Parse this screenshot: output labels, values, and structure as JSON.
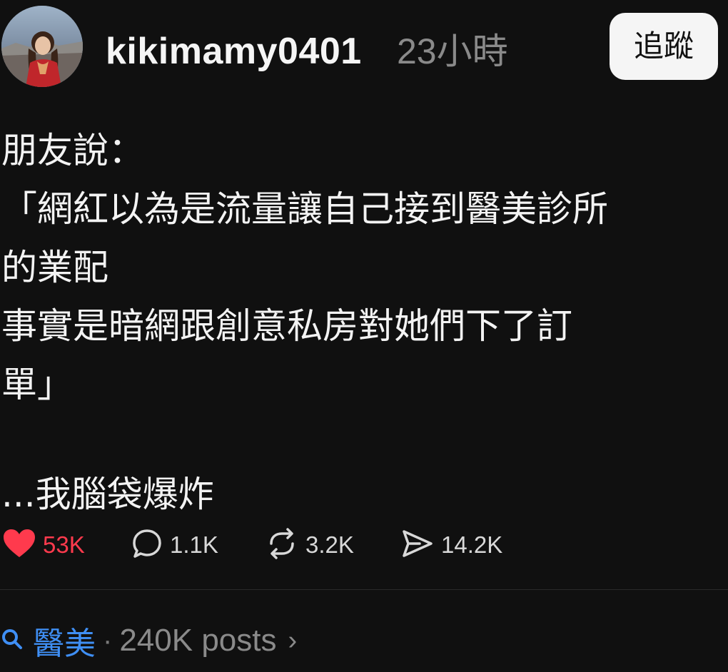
{
  "post": {
    "username": "kikimamy0401",
    "timestamp": "23小時",
    "follow_label": "追蹤",
    "body_lines": [
      "朋友說：",
      "「網紅以為是流量讓自己接到醫美診所",
      "的業配",
      "事實是暗網跟創意私房對她們下了訂",
      "單」",
      "",
      "...我腦袋爆炸"
    ]
  },
  "actions": {
    "likes": "53K",
    "replies": "1.1K",
    "reposts": "3.2K",
    "shares": "14.2K"
  },
  "topic": {
    "name": "醫美",
    "separator": "·",
    "posts_count": "240K posts",
    "chevron": "›"
  },
  "colors": {
    "background": "#101010",
    "like_red": "#ff3a4d",
    "topic_blue": "#3f8ff5",
    "muted_gray": "#8a8a8a"
  },
  "icons": [
    "heart-icon",
    "comment-icon",
    "repost-icon",
    "share-icon",
    "search-icon",
    "chevron-right-icon"
  ]
}
